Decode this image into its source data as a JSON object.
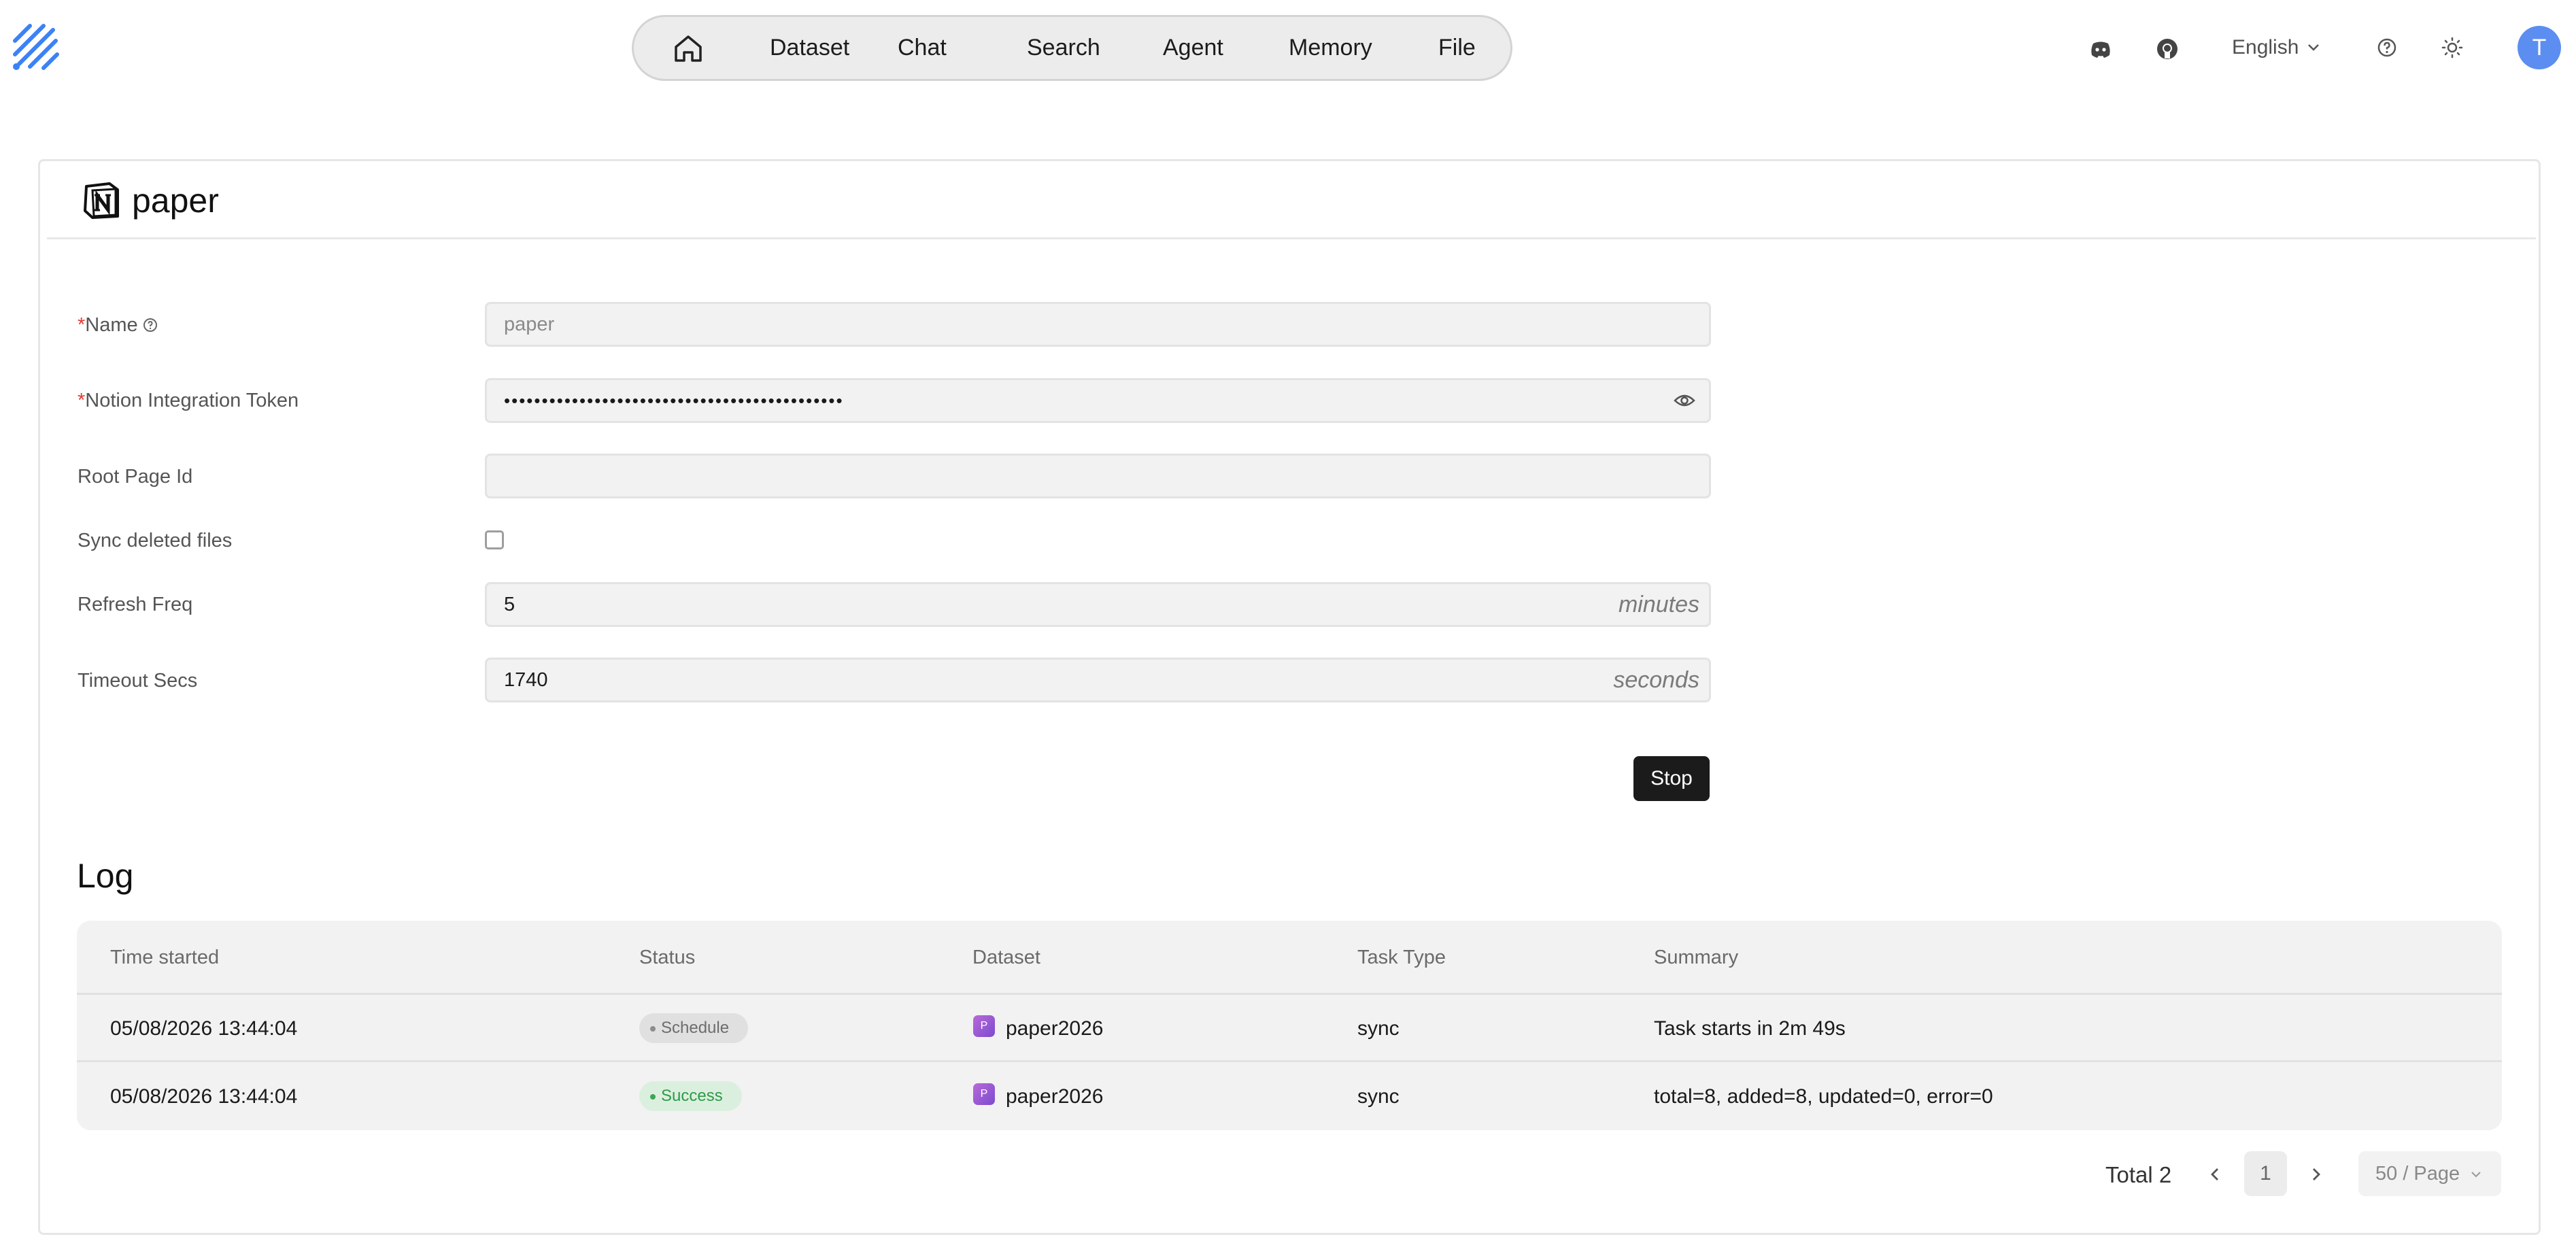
{
  "header": {
    "nav": {
      "home_icon": "home-icon",
      "items": [
        {
          "label": "Dataset"
        },
        {
          "label": "Chat"
        },
        {
          "label": "Search"
        },
        {
          "label": "Agent"
        },
        {
          "label": "Memory"
        },
        {
          "label": "File"
        }
      ]
    },
    "icons": [
      "discord-icon",
      "github-icon",
      "help-icon",
      "sun-icon"
    ],
    "language": "English",
    "avatar_initial": "T"
  },
  "connector": {
    "title": "paper",
    "icon": "notion-icon"
  },
  "form": {
    "name": {
      "required": "*",
      "label": "Name",
      "value": "paper"
    },
    "token": {
      "required": "*",
      "label": "Notion Integration Token",
      "value": "•••••••••••••••••••••••••••••••••••••••••••••"
    },
    "root_page": {
      "label": "Root Page Id",
      "value": ""
    },
    "sync_deleted": {
      "label": "Sync deleted files",
      "checked": false
    },
    "refresh_freq": {
      "label": "Refresh Freq",
      "value": "5",
      "suffix": "minutes"
    },
    "timeout": {
      "label": "Timeout Secs",
      "value": "1740",
      "suffix": "seconds"
    },
    "stop_label": "Stop"
  },
  "log": {
    "title": "Log",
    "columns": [
      "Time started",
      "Status",
      "Dataset",
      "Task Type",
      "Summary"
    ],
    "rows": [
      {
        "time": "05/08/2026 13:44:04",
        "status": "Schedule",
        "dataset_initial": "P",
        "dataset": "paper2026",
        "task_type": "sync",
        "summary": "Task starts in 2m 49s"
      },
      {
        "time": "05/08/2026 13:44:04",
        "status": "Success",
        "dataset_initial": "P",
        "dataset": "paper2026",
        "task_type": "sync",
        "summary": "total=8, added=8, updated=0, error=0"
      }
    ],
    "pagination": {
      "total": "Total 2",
      "current_page": "1",
      "page_size": "50 / Page"
    }
  },
  "colors": {
    "accent": "#3b82f6",
    "avatar": "#5b8ef0",
    "button": "#1b1b1b",
    "success": "#2e9a47",
    "required": "#e53935"
  }
}
